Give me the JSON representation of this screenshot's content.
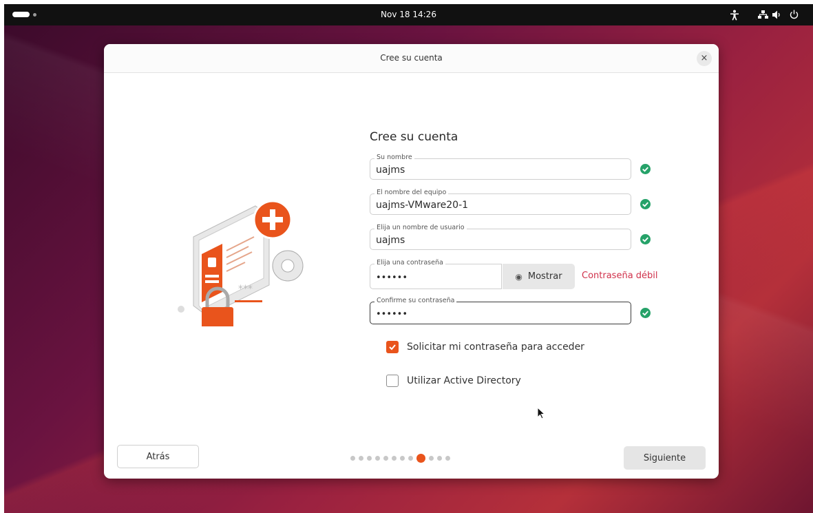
{
  "topbar": {
    "clock": "Nov 18  14:26",
    "tray_icons": [
      "accessibility-icon",
      "network-icon",
      "volume-icon",
      "power-icon"
    ]
  },
  "dialog": {
    "header_title": "Cree su cuenta",
    "close_label": "×",
    "page_title": "Cree su cuenta",
    "fields": {
      "name": {
        "label": "Su nombre",
        "value": "uajms",
        "valid": true
      },
      "computer": {
        "label": "El nombre del equipo",
        "value": "uajms-VMware20-1",
        "valid": true
      },
      "username": {
        "label": "Elija un nombre de usuario",
        "value": "uajms",
        "valid": true
      },
      "password": {
        "label": "Elija una contraseña",
        "value": "••••••",
        "strength": "Contraseña débil"
      },
      "confirm": {
        "label": "Confirme su contraseña",
        "value": "••••••",
        "valid": true
      }
    },
    "show_button": "Mostrar",
    "options": {
      "require_password": {
        "label": "Solicitar mi contraseña para acceder",
        "checked": true
      },
      "active_directory": {
        "label": "Utilizar Active Directory",
        "checked": false
      }
    },
    "back_button": "Atrás",
    "next_button": "Siguiente",
    "pager": {
      "total": 12,
      "current": 9
    }
  },
  "colors": {
    "accent": "#e9541c",
    "valid": "#26a269",
    "weak": "#d0304a"
  }
}
